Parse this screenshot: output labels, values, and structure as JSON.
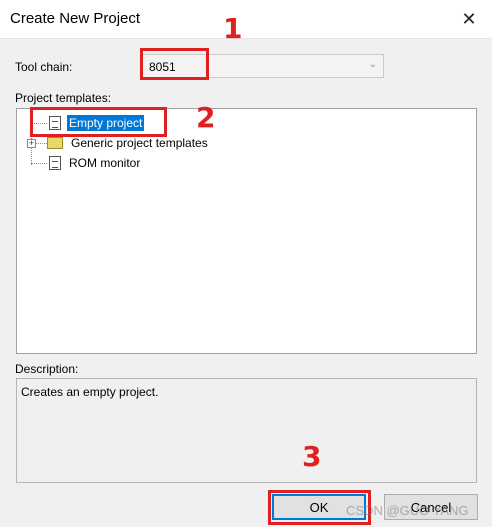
{
  "window": {
    "title": "Create New Project",
    "close_glyph": "✕"
  },
  "toolchain": {
    "label": "Tool chain:",
    "value": "8051",
    "chevron": "⌄"
  },
  "templates": {
    "label": "Project templates:",
    "items": [
      {
        "label": "Empty project",
        "icon": "document-icon",
        "selected": true
      },
      {
        "label": "Generic project templates",
        "icon": "folder-icon",
        "expander": "+"
      },
      {
        "label": "ROM monitor",
        "icon": "document-icon"
      }
    ]
  },
  "description": {
    "label": "Description:",
    "text": "Creates an empty project."
  },
  "buttons": {
    "ok": "OK",
    "cancel": "Cancel"
  },
  "annotations": {
    "one": "1",
    "two": "2",
    "three": "3",
    "color": "#e02020"
  },
  "watermark": "CSDN @GUO YANG"
}
